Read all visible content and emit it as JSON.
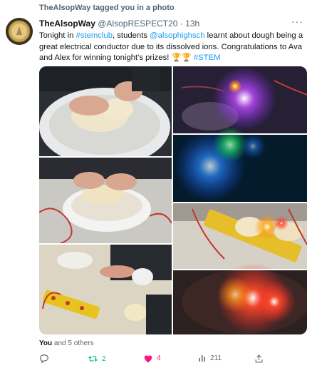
{
  "tagged_header": "TheAlsopWay tagged you in a photo",
  "author": {
    "display_name": "TheAlsopWay",
    "handle": "@AlsopRESPECT20",
    "separator": "·",
    "time": "13h",
    "avatar_text": "ALSOP SINCE 1972"
  },
  "tweet": {
    "part1": "Tonight in ",
    "hashtag1": "#stemclub",
    "part2": ", students ",
    "mention": "@alsophighsch",
    "part3": " learnt about dough being a great electrical conductor due to its dissolved ions. Congratulations to Ava and Alex for winning tonight's prizes! ",
    "emoji": "🏆🏆",
    "hashtag2": "#STEM"
  },
  "liked_by": {
    "first": "You",
    "rest": " and 5 others"
  },
  "actions": {
    "retweets": "2",
    "likes": "4",
    "views": "211"
  },
  "colors": {
    "link": "#1d9bf0",
    "retweet": "#00ba7c",
    "like": "#f91880",
    "muted": "#536471"
  },
  "icons": {
    "more": "more-icon",
    "reply": "reply-icon",
    "retweet": "retweet-icon",
    "like": "heart-icon",
    "views": "views-icon",
    "share": "share-icon"
  }
}
